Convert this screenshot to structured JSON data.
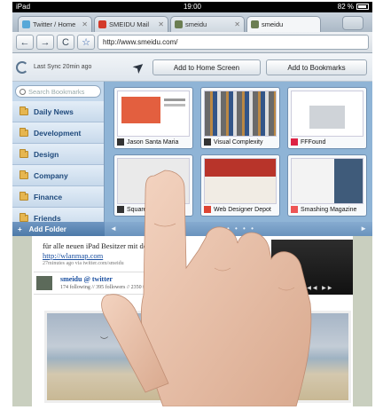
{
  "status": {
    "device": "iPad",
    "time": "19:00",
    "battery": "82 %"
  },
  "tabs": [
    {
      "label": "Twitter / Home",
      "fav_color": "#57a8d8",
      "active": false
    },
    {
      "label": "SMEIDU Mail",
      "fav_color": "#d33a2a",
      "active": false
    },
    {
      "label": "smeidu",
      "fav_color": "#6b7e52",
      "active": false
    },
    {
      "label": "smeidu",
      "fav_color": "#6b7e52",
      "active": true
    }
  ],
  "nav": {
    "back": "←",
    "forward": "→",
    "reload": "C",
    "star": "☆",
    "url": "http://www.smeidu.com/"
  },
  "sync": {
    "text": "Last Sync 20min ago",
    "add_home": "Add to Home Screen",
    "add_bookmarks": "Add to Bookmarks"
  },
  "sidebar": {
    "search_placeholder": "Search Bookmarks",
    "folders": [
      "Daily News",
      "Development",
      "Design",
      "Company",
      "Finance",
      "Friends"
    ],
    "add_folder": "Add Folder"
  },
  "bookmarks": [
    {
      "title": "Jason Santa Maria",
      "shot_color": "#e35f3f"
    },
    {
      "title": "Visual Complexity",
      "shot_color": "#5a5a5a"
    },
    {
      "title": "FFFound",
      "shot_color": "#cfd3d8"
    },
    {
      "title": "Squaresp",
      "shot_color": "#e8e8e8"
    },
    {
      "title": "Web Designer Depot",
      "shot_color": "#b8342a"
    },
    {
      "title": "Smashing Magazine",
      "shot_color": "#3f5b7a"
    }
  ],
  "thumb_nav": {
    "prev": "◄",
    "next": "►",
    "dots": "• • • •"
  },
  "webpage": {
    "tweet_text": "für alle neuen iPad Besitzer mit der",
    "tweet_link": "http://wlanmap.com",
    "tweet_meta": "27minutes ago via twitter.com/smeidu",
    "profile_name": "smeidu @ twitter",
    "profile_stats": "174 following // 395 followers // 2350 tweets"
  }
}
